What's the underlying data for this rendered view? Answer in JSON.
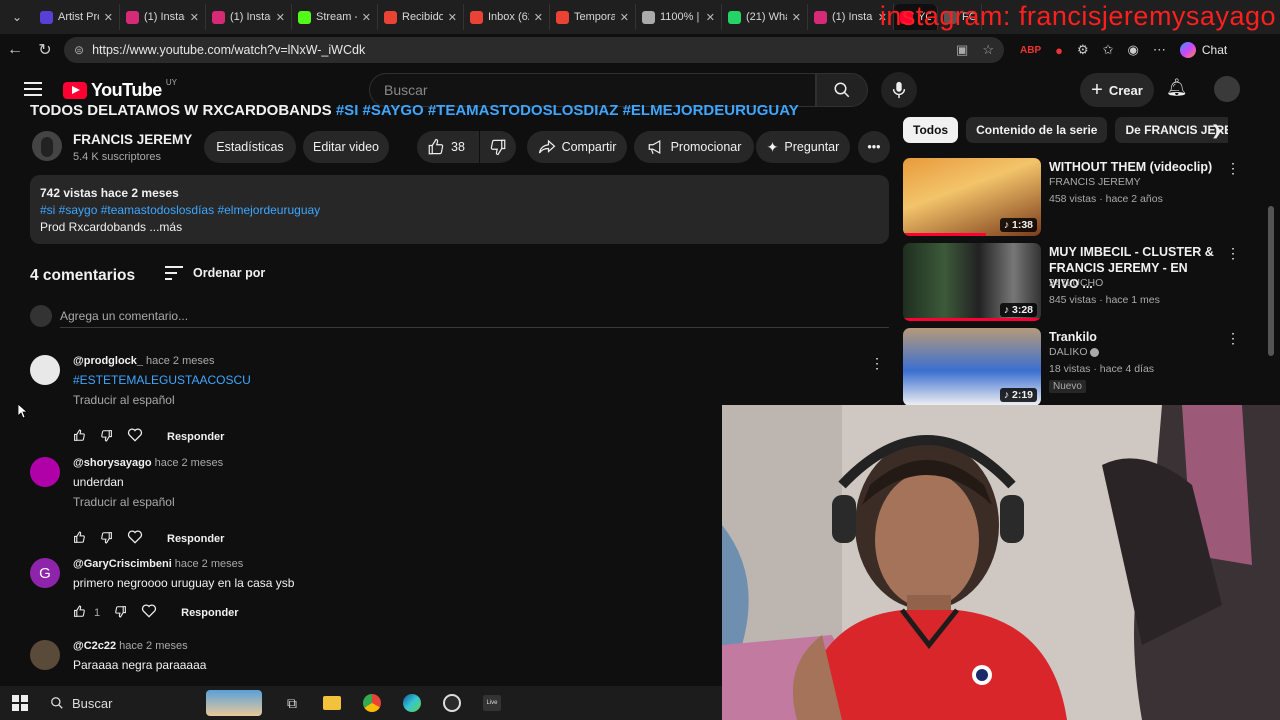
{
  "browser": {
    "tabs": [
      {
        "title": "Artist Pro",
        "color": "#5a3fd6"
      },
      {
        "title": "(1) Instag",
        "color": "#d62976"
      },
      {
        "title": "(1) Instag",
        "color": "#d62976"
      },
      {
        "title": "Stream -",
        "color": "#53fc18"
      },
      {
        "title": "Recibidos",
        "color": "#ea4335"
      },
      {
        "title": "Inbox (62",
        "color": "#ea4335"
      },
      {
        "title": "Temporar",
        "color": "#ea4335"
      },
      {
        "title": "1100% | M",
        "color": "#aaaaaa"
      },
      {
        "title": "(21) Wha",
        "color": "#25d366"
      },
      {
        "title": "(1) Insta",
        "color": "#d62976"
      },
      {
        "title": "YOU",
        "color": "#ff0033"
      },
      {
        "title": "FO",
        "color": "#555555"
      }
    ],
    "overlay_text": "instagram: francisjeremysayago",
    "url": "https://www.youtube.com/watch?v=lNxW-_iWCdk",
    "chat_label": "Chat"
  },
  "header": {
    "logo_text": "YouTube",
    "logo_country": "UY",
    "search_placeholder": "Buscar",
    "create_label": "Crear"
  },
  "video": {
    "title_fragment": "TODOS DELATAMOS W RXCARDOBANDS",
    "title_tags": "#SI #SAYGO #TEAMASTODOSLOSDIAZ #ELMEJORDEURUGUAY",
    "channel_name": "FRANCIS JEREMY",
    "subscribers": "5.4 K suscriptores",
    "btn_stats": "Estadísticas",
    "btn_edit": "Editar video",
    "likes": "38",
    "btn_share": "Compartir",
    "btn_promote": "Promocionar",
    "btn_ask": "Preguntar",
    "description": {
      "meta": "742 vistas  hace 2 meses",
      "tags": "#si #saygo #teamastodoslosdías #elmejordeuruguay",
      "text": "Prod Rxcardobands ...más"
    }
  },
  "comments": {
    "count_label": "4 comentarios",
    "order_label": "Ordenar por",
    "add_placeholder": "Agrega un comentario...",
    "translate_label": "Traducir al español",
    "reply_label": "Responder",
    "items": [
      {
        "user": "@prodglock_",
        "time": "hace 2 meses",
        "text": "#ESTETEMALEGUSTAACOSCU",
        "likes": ""
      },
      {
        "user": "@shorysayago",
        "time": "hace 2 meses",
        "text": "underdan",
        "likes": ""
      },
      {
        "user": "@GaryCriscimbeni",
        "time": "hace 2 meses",
        "text": "primero negroooo uruguay en la casa ysb",
        "likes": "1",
        "initial": "G"
      },
      {
        "user": "@C2c22",
        "time": "hace 2 meses",
        "text": "Paraaaa negra paraaaaa",
        "likes": ""
      }
    ]
  },
  "sidebar": {
    "chips": [
      "Todos",
      "Contenido de la serie",
      "De FRANCIS JEREMY"
    ],
    "recommendations": [
      {
        "title": "WITHOUT THEM (videoclip)",
        "channel": "FRANCIS JEREMY",
        "meta": "458 vistas · hace 2 años",
        "duration": "1:38",
        "progress": 0.6
      },
      {
        "title": "MUY IMBECIL - CLUSTER & FRANCIS JEREMY - EN VIVO ...",
        "channel": "247LUCHO",
        "meta": "845 vistas · hace 1 mes",
        "duration": "3:28",
        "progress": 1.0
      },
      {
        "title": "Trankilo",
        "channel": "DALIKO",
        "meta": "18 vistas · hace 4 días",
        "duration": "2:19",
        "badge": "Nuevo",
        "progress": 0
      }
    ]
  },
  "taskbar": {
    "search_label": "Buscar"
  },
  "colors": {
    "accent_link": "#3ea6ff",
    "brand_red": "#ff0033",
    "overlay_red": "#ff1f1f"
  }
}
